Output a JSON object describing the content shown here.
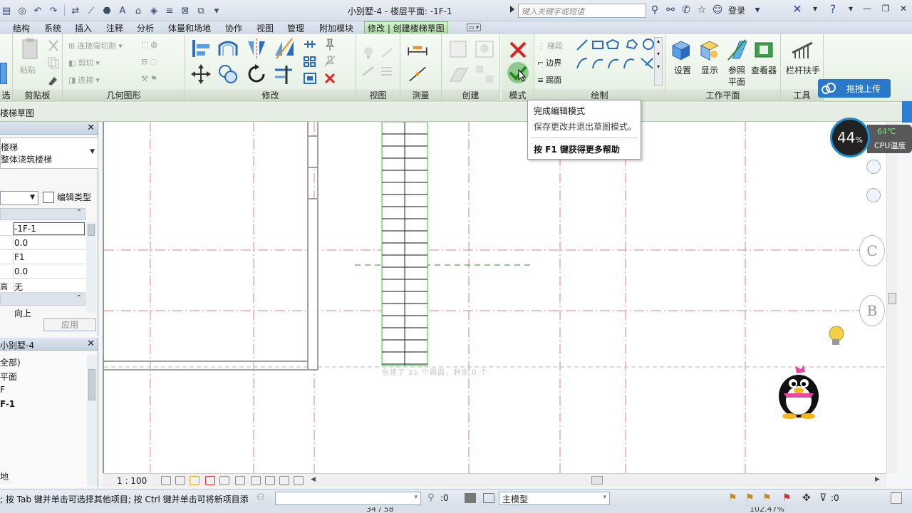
{
  "title_bar": {
    "doc_title": "小别墅-4 - 楼层平面: -1F-1",
    "search_placeholder": "键入关键字或短语",
    "login_label": "登录"
  },
  "tabs": [
    {
      "label": "结构",
      "active": false
    },
    {
      "label": "系统",
      "active": false
    },
    {
      "label": "插入",
      "active": false
    },
    {
      "label": "注释",
      "active": false
    },
    {
      "label": "分析",
      "active": false
    },
    {
      "label": "体量和场地",
      "active": false
    },
    {
      "label": "协作",
      "active": false
    },
    {
      "label": "视图",
      "active": false
    },
    {
      "label": "管理",
      "active": false
    },
    {
      "label": "附加模块",
      "active": false
    },
    {
      "label": "修改 | 创建楼梯草图",
      "active": true
    }
  ],
  "ribbon": {
    "clipboard": {
      "title": "剪贴板",
      "paste": "粘贴"
    },
    "geometry": {
      "title": "几何图形",
      "join_cut": "连接端切割",
      "cut": "剪切",
      "join": "连接"
    },
    "modify": {
      "title": "修改"
    },
    "view": {
      "title": "视图"
    },
    "measure": {
      "title": "测量"
    },
    "create": {
      "title": "创建"
    },
    "mode": {
      "title": "模式"
    },
    "draw": {
      "title": "绘制",
      "run": "梯段",
      "boundary": "边界",
      "riser": "踢面"
    },
    "workplane": {
      "title": "工作平面",
      "set": "设置",
      "show": "显示",
      "ref_plane_1": "参照",
      "ref_plane_2": "平面",
      "viewer": "查看器"
    },
    "tools": {
      "title": "工具",
      "railing": "栏杆扶手"
    }
  },
  "options_bar": {
    "label": "楼梯草图"
  },
  "properties": {
    "type_line1": "楼梯",
    "type_line2": "整体浇筑楼梯",
    "edit_type": "编辑类型",
    "rows": [
      {
        "name": "",
        "value": "-1F-1"
      },
      {
        "name": "",
        "value": "0.0"
      },
      {
        "name": "",
        "value": "F1"
      },
      {
        "name": "",
        "value": "0.0"
      },
      {
        "name": "高",
        "value": "无"
      }
    ],
    "dir_row": "向上",
    "apply": "应用"
  },
  "browser": {
    "title": "小别墅-4",
    "items": [
      {
        "label": "全部)",
        "bold": false
      },
      {
        "label": "平面",
        "bold": false
      },
      {
        "label": "F",
        "bold": false
      },
      {
        "label": "F-1",
        "bold": true
      },
      {
        "label": "地",
        "bold": false
      }
    ]
  },
  "canvas": {
    "hint": "创建了 21 个踢面，剩余 0 个",
    "grid_bubbles": [
      "C",
      "B"
    ]
  },
  "tooltip": {
    "title": "完成编辑模式",
    "desc": "保存更改并退出草图模式。",
    "help": "按 F1 键获得更多帮助"
  },
  "upload": {
    "label": "拖拽上传"
  },
  "cpu": {
    "percent": "44",
    "unit": "%",
    "temp": "64℃",
    "label": "CPU温度"
  },
  "view_bar": {
    "scale": "1 : 100"
  },
  "status": {
    "message": "; 按 Tab 键并单击可选择其他项目; 按 Ctrl 键并单击可将新项目添",
    "zero1": ":0",
    "model": "主模型",
    "zero2": ":0"
  },
  "bottom": {
    "page": "34 / 58",
    "zoom": "102.47%"
  },
  "colors": {
    "accent": "#2a78c9",
    "ribbon_green": "#a9dca1",
    "grid_red": "#e48080",
    "stair_green": "#3cc23c",
    "stair_blue": "#1a1aa0"
  }
}
